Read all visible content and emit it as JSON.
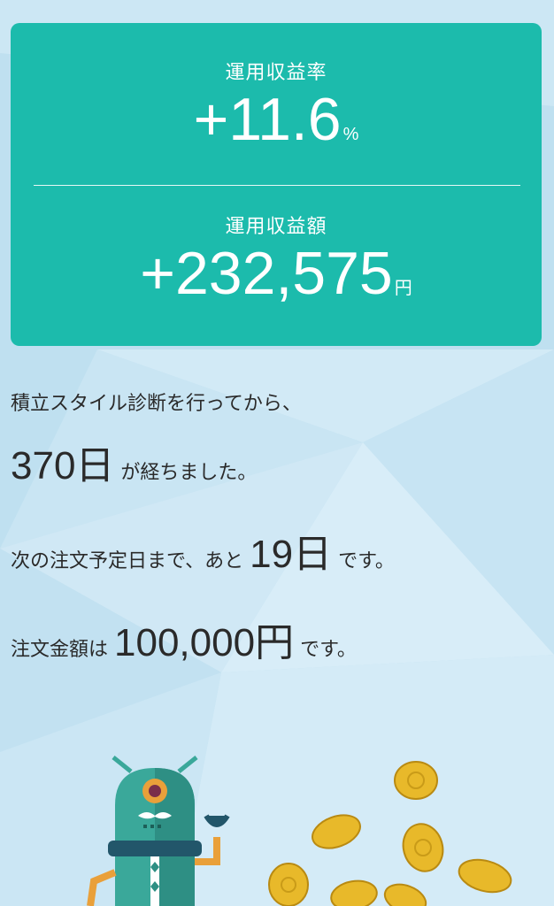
{
  "return_rate": {
    "label": "運用収益率",
    "value": "+11.6",
    "unit": "%"
  },
  "return_amount": {
    "label": "運用収益額",
    "value": "+232,575",
    "unit": "円"
  },
  "diagnosis": {
    "line1": "積立スタイル診断を行ってから、",
    "days": "370日",
    "days_suffix": "が経ちました。"
  },
  "next_order": {
    "prefix": "次の注文予定日まで、あと",
    "days": "19日",
    "suffix": "です。"
  },
  "order_amount": {
    "prefix": "注文金額は",
    "amount": "100,000円",
    "suffix": "です。"
  },
  "colors": {
    "accent": "#1cbbac",
    "text": "#2a2a2a",
    "coin": "#e8b92a"
  },
  "icons": [
    "robot-mascot-icon",
    "gold-coin-icon"
  ]
}
